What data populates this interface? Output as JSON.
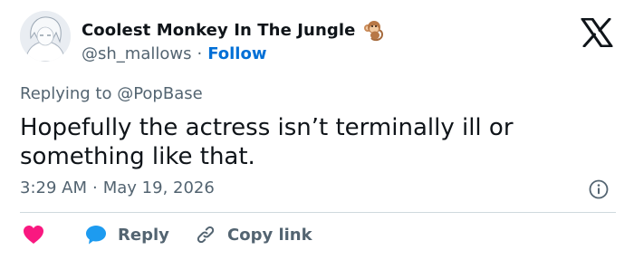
{
  "author": {
    "display_name": "Coolest Monkey In The Jungle",
    "handle": "@sh_mallows",
    "separator": "·",
    "follow_label": "Follow",
    "emoji_icon": "monkey-icon",
    "avatar_icon": "anime-avatar"
  },
  "reply_context": {
    "prefix": "Replying to ",
    "mention": "@PopBase"
  },
  "tweet": {
    "text": "Hopefully the actress isn’t terminally ill or something like that.",
    "time": "3:29 AM",
    "separator": "·",
    "date": "May 19, 2026"
  },
  "actions": {
    "reply_label": "Reply",
    "copy_link_label": "Copy link"
  },
  "colors": {
    "link_blue": "#006fd6",
    "heart_red": "#f91880",
    "reply_blue": "#1d9bf0",
    "secondary_text": "#536471",
    "divider": "#cfd9de"
  }
}
